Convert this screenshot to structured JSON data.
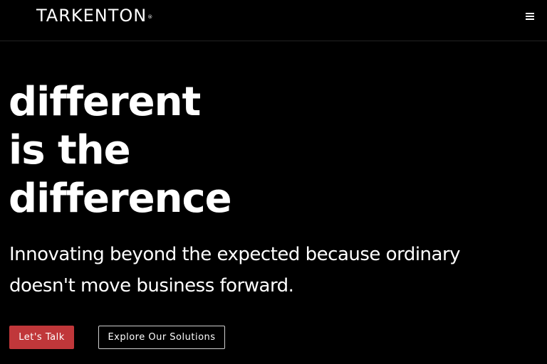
{
  "header": {
    "logo_text": "TARKENTON",
    "logo_mark": "®",
    "menu_icon": "hamburger-menu-icon"
  },
  "hero": {
    "headline_lines": [
      "different",
      "is the",
      "difference"
    ],
    "subtitle_lines": [
      "Innovating beyond the expected because ordinary",
      "doesn't move business forward."
    ]
  },
  "cta": {
    "primary_label": "Let's Talk",
    "secondary_label": "Explore Our Solutions"
  },
  "colors": {
    "background": "#000000",
    "text": "#ffffff",
    "accent": "#c0373a"
  }
}
